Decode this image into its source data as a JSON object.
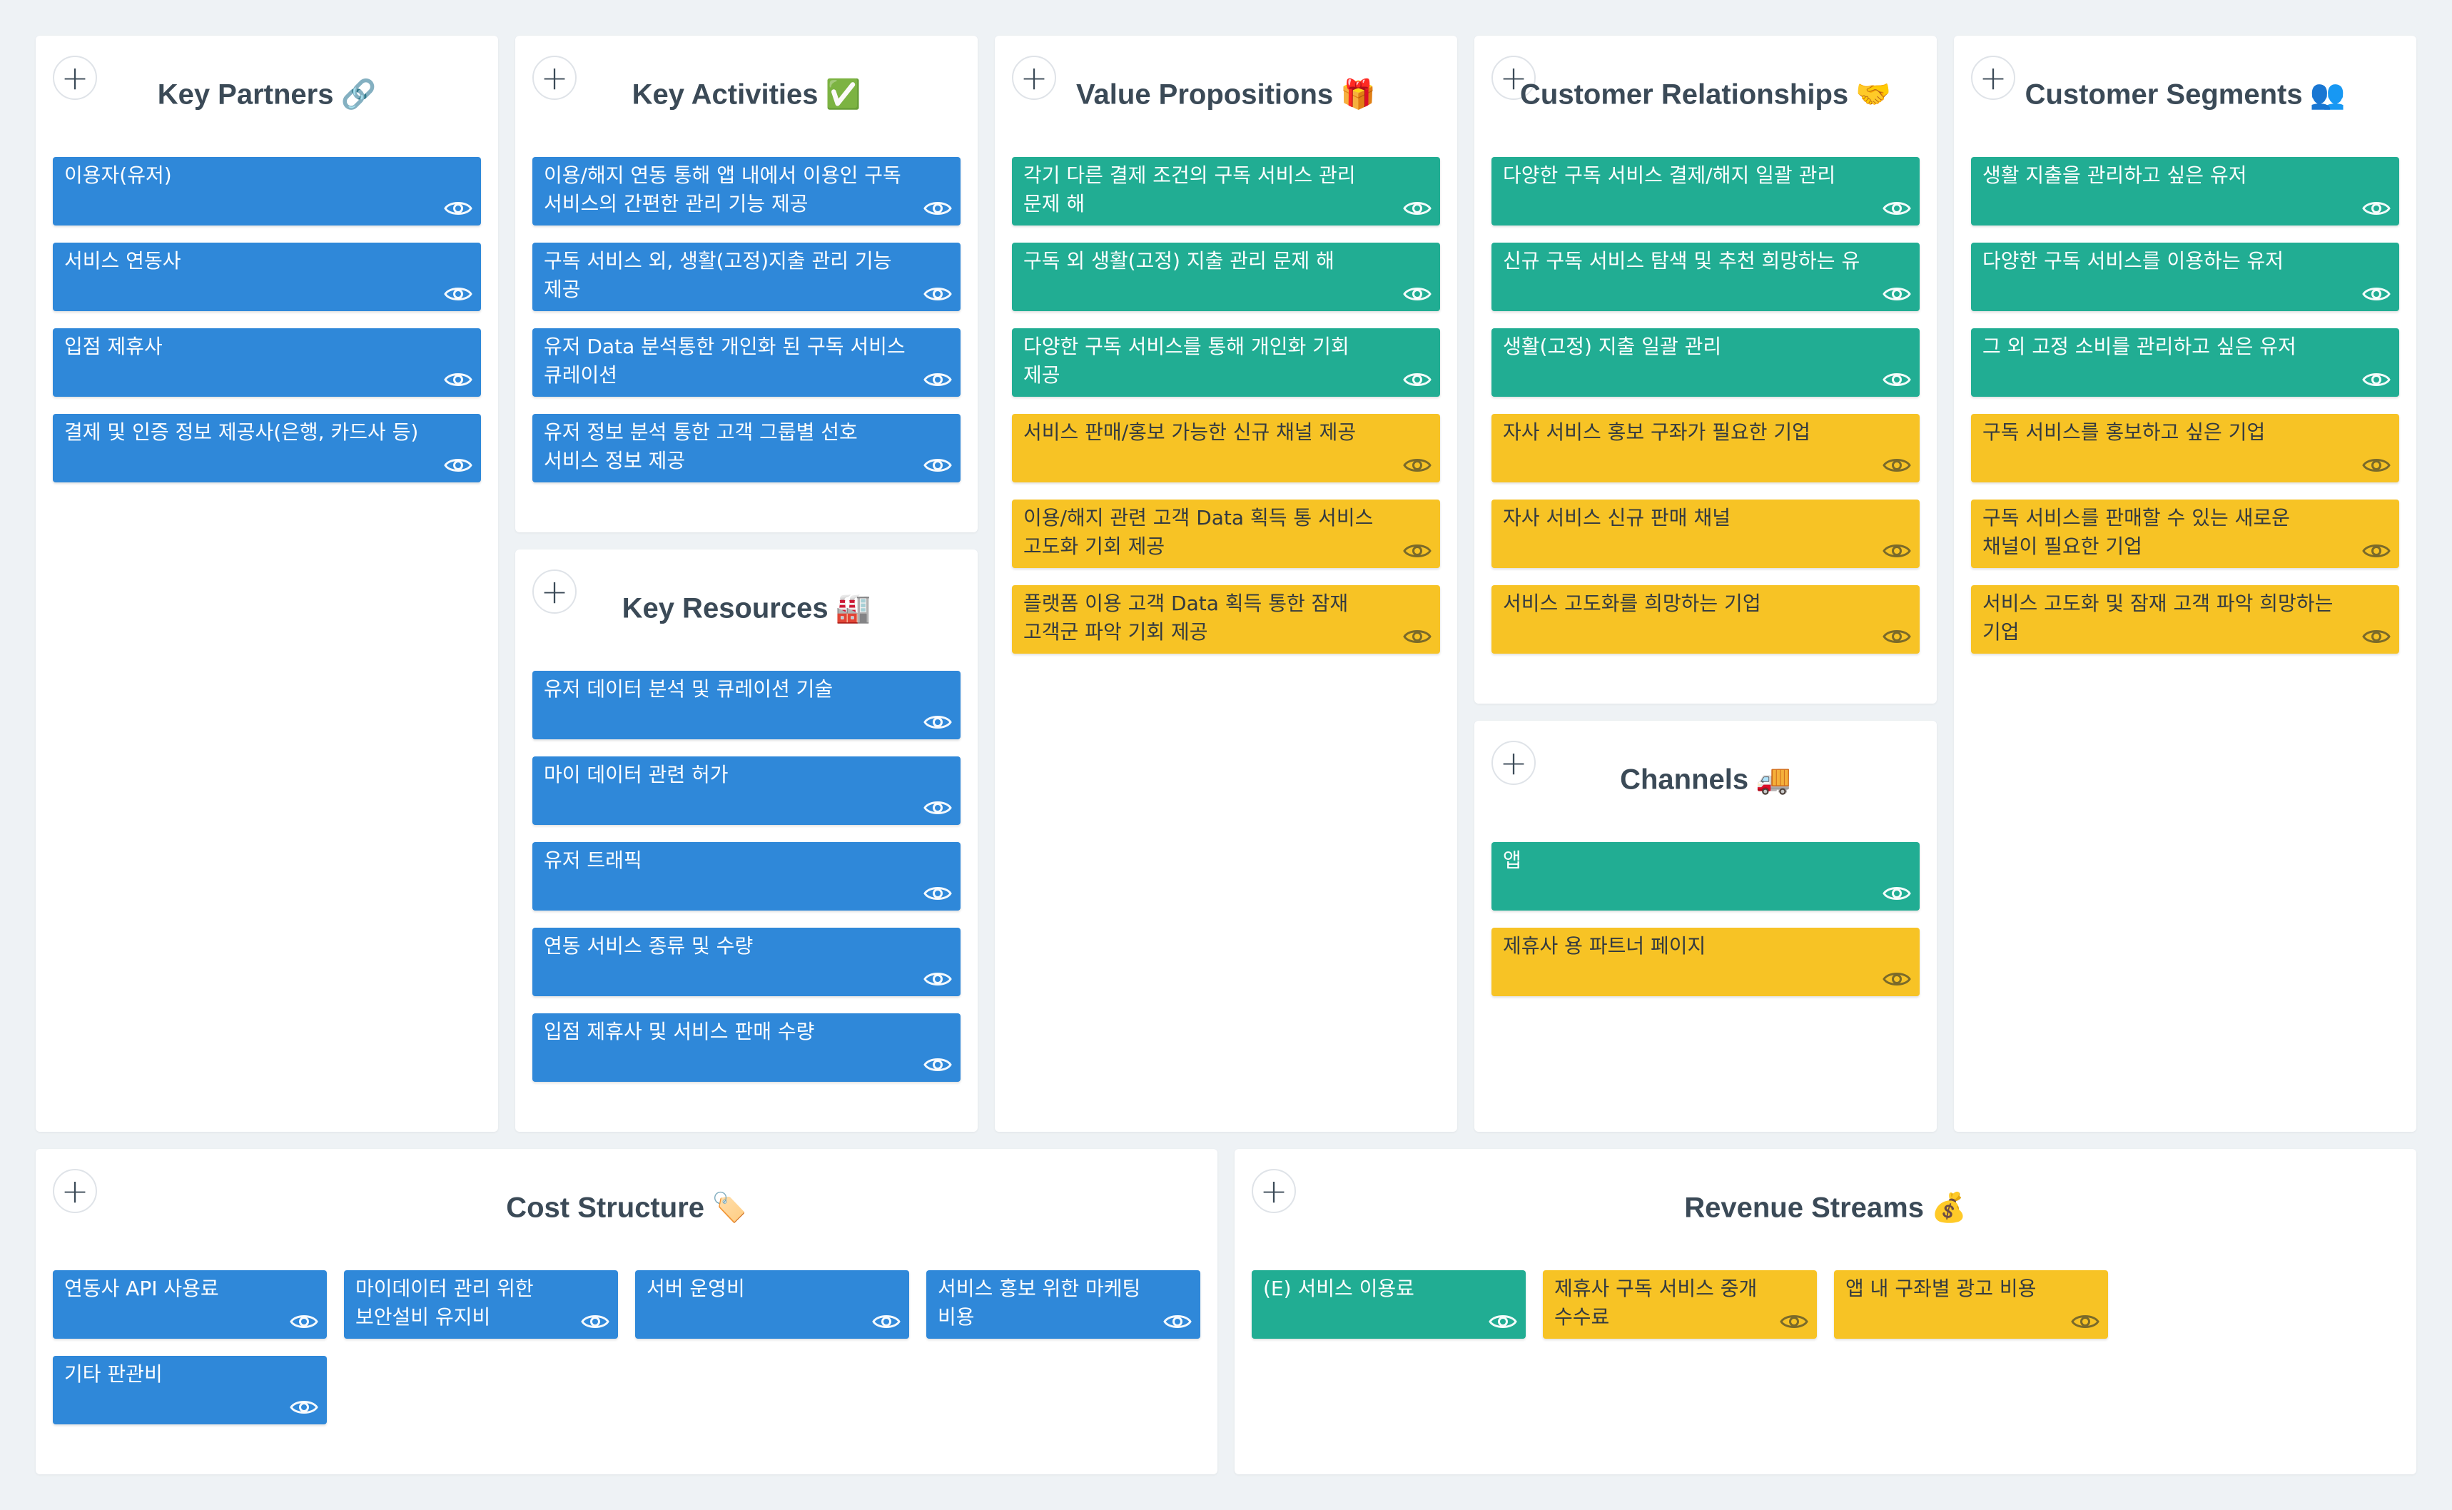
{
  "colors": {
    "background": "#eef2f5",
    "panel": "#ffffff",
    "blue": "#2f88d9",
    "teal": "#21ad93",
    "yellow": "#f7c325",
    "title": "#3b4a57"
  },
  "panels": {
    "key_partners": {
      "title": "Key Partners",
      "emoji": "🔗",
      "cards": [
        {
          "text": "이용자(유저)",
          "color": "blue"
        },
        {
          "text": "서비스 연동사",
          "color": "blue"
        },
        {
          "text": "입점 제휴사",
          "color": "blue"
        },
        {
          "text": "결제 및 인증 정보 제공사(은행, 카드사 등)",
          "color": "blue"
        }
      ]
    },
    "key_activities": {
      "title": "Key Activities",
      "emoji": "✅",
      "cards": [
        {
          "text": "이용/해지 연동 통해 앱 내에서 이용인 구독 서비스의 간편한 관리 기능 제공",
          "color": "blue"
        },
        {
          "text": "구독 서비스 외, 생활(고정)지출 관리 기능 제공",
          "color": "blue"
        },
        {
          "text": "유저 Data 분석통한 개인화 된 구독 서비스 큐레이션",
          "color": "blue"
        },
        {
          "text": "유저 정보 분석 통한 고객 그룹별 선호 서비스 정보 제공",
          "color": "blue"
        }
      ]
    },
    "key_resources": {
      "title": "Key Resources",
      "emoji": "🏭",
      "cards": [
        {
          "text": "유저 데이터 분석 및 큐레이션 기술",
          "color": "blue"
        },
        {
          "text": "마이 데이터 관련 허가",
          "color": "blue"
        },
        {
          "text": "유저 트래픽",
          "color": "blue"
        },
        {
          "text": "연동 서비스 종류 및 수량",
          "color": "blue"
        },
        {
          "text": "입점 제휴사 및 서비스 판매 수량",
          "color": "blue"
        }
      ]
    },
    "value_propositions": {
      "title": "Value Propositions",
      "emoji": "🎁",
      "cards": [
        {
          "text": "각기 다른 결제 조건의 구독 서비스 관리 문제 해",
          "color": "teal"
        },
        {
          "text": "구독 외 생활(고정) 지출 관리 문제 해",
          "color": "teal"
        },
        {
          "text": "다양한 구독 서비스를 통해 개인화 기회 제공",
          "color": "teal"
        },
        {
          "text": "서비스 판매/홍보 가능한 신규 채널 제공",
          "color": "yellow"
        },
        {
          "text": "이용/해지 관련 고객 Data 획득 통 서비스 고도화 기회 제공",
          "color": "yellow"
        },
        {
          "text": "플랫폼 이용 고객 Data 획득 통한 잠재 고객군 파악 기회 제공",
          "color": "yellow"
        }
      ]
    },
    "customer_relationships": {
      "title": "Customer Relationships",
      "emoji": "🤝",
      "cards": [
        {
          "text": "다양한 구독 서비스 결제/해지 일괄 관리",
          "color": "teal"
        },
        {
          "text": "신규 구독 서비스 탐색 및 추천 희망하는 유",
          "color": "teal"
        },
        {
          "text": "생활(고정) 지출 일괄 관리",
          "color": "teal"
        },
        {
          "text": "자사 서비스 홍보 구좌가 필요한 기업",
          "color": "yellow"
        },
        {
          "text": "자사 서비스 신규 판매 채널",
          "color": "yellow"
        },
        {
          "text": "서비스 고도화를 희망하는 기업",
          "color": "yellow"
        }
      ]
    },
    "channels": {
      "title": "Channels",
      "emoji": "🚚",
      "cards": [
        {
          "text": "앱",
          "color": "teal"
        },
        {
          "text": "제휴사 용 파트너 페이지",
          "color": "yellow"
        }
      ]
    },
    "customer_segments": {
      "title": "Customer Segments",
      "emoji": "👥",
      "cards": [
        {
          "text": "생활 지출을 관리하고 싶은 유저",
          "color": "teal"
        },
        {
          "text": "다양한 구독 서비스를 이용하는 유저",
          "color": "teal"
        },
        {
          "text": "그 외 고정 소비를 관리하고 싶은 유저",
          "color": "teal"
        },
        {
          "text": "구독 서비스를 홍보하고 싶은 기업",
          "color": "yellow"
        },
        {
          "text": "구독 서비스를 판매할 수 있는 새로운 채널이 필요한 기업",
          "color": "yellow"
        },
        {
          "text": "서비스 고도화 및 잠재 고객 파악 희망하는 기업",
          "color": "yellow"
        }
      ]
    },
    "cost_structure": {
      "title": "Cost Structure",
      "emoji": "🏷️",
      "cards": [
        {
          "text": "연동사 API 사용료",
          "color": "blue"
        },
        {
          "text": "마이데이터 관리 위한 보안설비 유지비",
          "color": "blue"
        },
        {
          "text": "서버 운영비",
          "color": "blue"
        },
        {
          "text": "서비스 홍보 위한 마케팅 비용",
          "color": "blue"
        },
        {
          "text": "기타 판관비",
          "color": "blue"
        }
      ]
    },
    "revenue_streams": {
      "title": "Revenue Streams",
      "emoji": "💰",
      "cards": [
        {
          "text": "(E) 서비스 이용료",
          "color": "teal"
        },
        {
          "text": "제휴사 구독 서비스 중개 수수료",
          "color": "yellow"
        },
        {
          "text": "앱 내 구좌별 광고 비용",
          "color": "yellow"
        }
      ]
    }
  },
  "icons": {
    "add": "plus-icon",
    "view": "eye-icon"
  }
}
